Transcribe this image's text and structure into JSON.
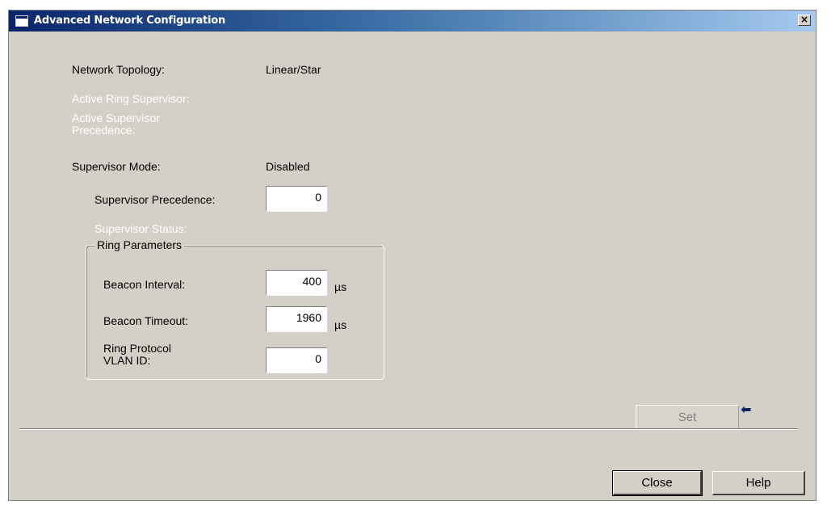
{
  "window": {
    "title": "Advanced Network Configuration",
    "close_glyph": "×"
  },
  "topology": {
    "label": "Network Topology:",
    "value": "Linear/Star"
  },
  "active_ring_supervisor": {
    "label": "Active Ring Supervisor:"
  },
  "active_supervisor_precedence": {
    "label": "Active Supervisor Precedence:"
  },
  "supervisor_mode": {
    "label": "Supervisor Mode:",
    "value": "Disabled"
  },
  "supervisor_precedence": {
    "label": "Supervisor Precedence:",
    "value": "0"
  },
  "supervisor_status": {
    "label": "Supervisor Status:"
  },
  "ring_parameters": {
    "title": "Ring Parameters",
    "beacon_interval": {
      "label": "Beacon Interval:",
      "value": "400",
      "unit": "µs"
    },
    "beacon_timeout": {
      "label": "Beacon Timeout:",
      "value": "1960",
      "unit": "µs"
    },
    "vlan_id": {
      "label": "Ring Protocol VLAN ID:",
      "value": "0"
    }
  },
  "buttons": {
    "set": "Set",
    "close": "Close",
    "help": "Help"
  },
  "icons": {
    "window_icon": "window-icon",
    "close_icon": "close-icon",
    "arrow_icon": "left-arrow-icon",
    "arrow_glyph": "⬅"
  },
  "colors": {
    "titlebar_start": "#0a246a",
    "titlebar_end": "#a6caf0",
    "dialog_background": "#d4d0c8",
    "disabled_text": "#ffffff"
  }
}
